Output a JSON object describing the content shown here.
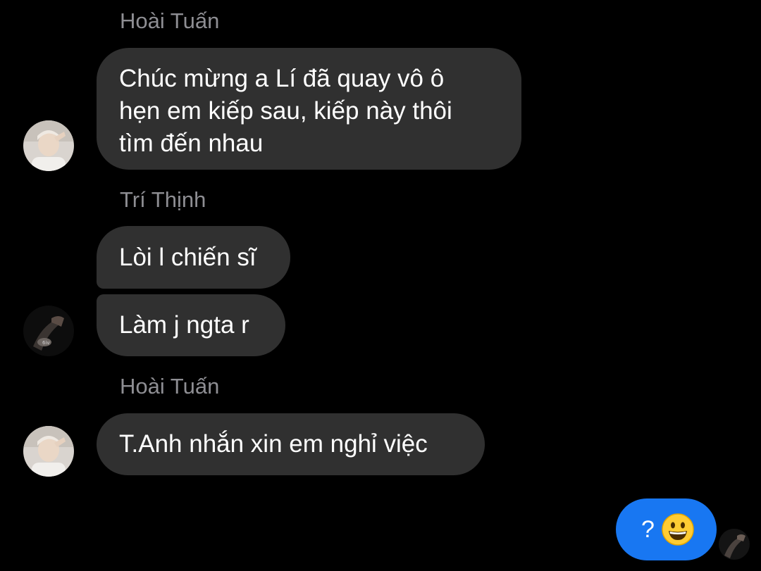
{
  "messages": [
    {
      "sender": "Hoài Tuấn",
      "bubbles": [
        {
          "lines": [
            "Chúc mừng a Lí đã quay vô ô",
            "hẹn em kiếp sau, kiếp này thôi",
            "tìm đến nhau"
          ]
        }
      ],
      "avatar": "avatar-hoai-tuan"
    },
    {
      "sender": "Trí Thịnh",
      "bubbles": [
        {
          "text": "Lòi l chiến sĩ"
        },
        {
          "text": "Làm j ngta r"
        }
      ],
      "avatar": "avatar-tri-thinh"
    },
    {
      "sender": "Hoài Tuấn",
      "bubbles": [
        {
          "text": "T.Anh nhắn xin em nghỉ việc"
        }
      ],
      "avatar": "avatar-hoai-tuan"
    }
  ],
  "outgoing": {
    "text": "?",
    "emoji_icon": "grinning-face-icon"
  },
  "seen_indicator": {
    "avatar": "avatar-tri-thinh"
  },
  "colors": {
    "background": "#000000",
    "incoming_bubble": "#303030",
    "outgoing_bubble": "#1877f2",
    "sender_name": "#8e8e93",
    "text": "#ffffff"
  }
}
